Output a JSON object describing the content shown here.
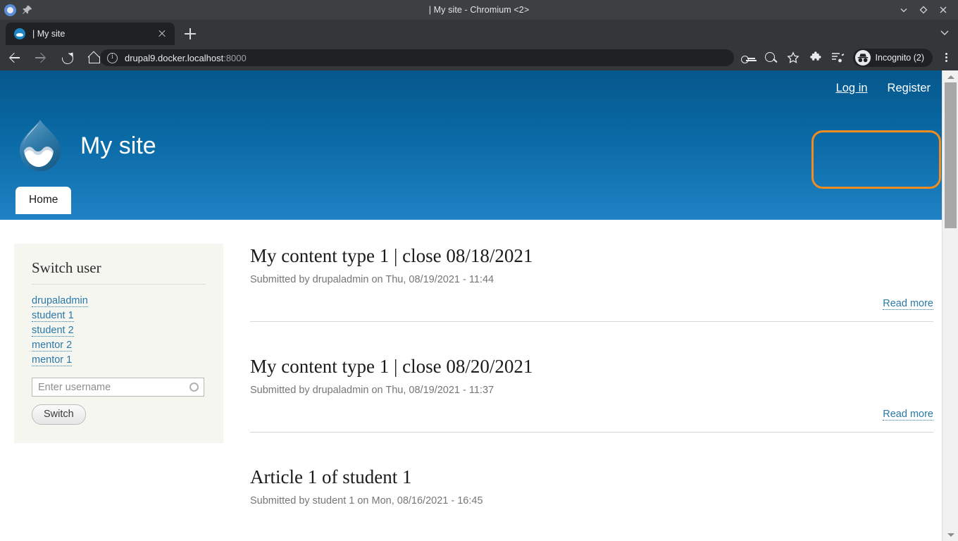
{
  "window": {
    "title": "| My site - Chromium <2>",
    "controls": {
      "minimize": "minimize-icon",
      "maximize": "maximize-icon",
      "close": "close-icon"
    }
  },
  "browser": {
    "tab": {
      "title": "| My site",
      "favicon": "drupal-favicon",
      "close_label": "close-tab"
    },
    "new_tab_label": "new-tab",
    "omnibox": {
      "url_host": "drupal9.docker.localhost",
      "url_port": ":8000",
      "info_icon": "site-info-icon"
    },
    "toolbar_icons": [
      "back-icon",
      "forward-icon",
      "reload-icon",
      "home-icon"
    ],
    "right_icons": [
      "password-key-icon",
      "zoom-icon",
      "bookmark-star-icon",
      "extensions-puzzle-icon",
      "media-control-icon"
    ],
    "profile_chip": {
      "label": "Incognito (2)",
      "icon": "incognito-icon"
    },
    "menu": "chrome-menu-icon"
  },
  "site": {
    "name": "My site",
    "logo": "drupal-droplet-logo",
    "user_links": [
      {
        "label": "Log in",
        "underlined": true
      },
      {
        "label": "Register",
        "underlined": false
      }
    ],
    "primary_tabs": [
      {
        "label": "Home",
        "active": true
      }
    ],
    "highlight_color": "#f08c20",
    "header_gradient": {
      "top": "#05578c",
      "bottom": "#2082c4"
    }
  },
  "sidebar": {
    "block_title": "Switch user",
    "users": [
      "drupaladmin",
      "student 1",
      "student 2",
      "mentor 2",
      "mentor 1"
    ],
    "username_field": {
      "value": "",
      "placeholder": "Enter username"
    },
    "throbber": "autocomplete-throbber-icon",
    "submit_label": "Switch"
  },
  "content": {
    "read_more_label": "Read more",
    "nodes": [
      {
        "title": "My content type 1 | close 08/18/2021",
        "submitted": "Submitted by drupaladmin on Thu, 08/19/2021 - 11:44",
        "has_read_more": true
      },
      {
        "title": "My content type 1 | close 08/20/2021",
        "submitted": "Submitted by drupaladmin on Thu, 08/19/2021 - 11:37",
        "has_read_more": true
      },
      {
        "title": "Article 1 of student 1",
        "submitted": "Submitted by student 1 on Mon, 08/16/2021 - 16:45",
        "has_read_more": false
      }
    ]
  },
  "scrollbar": {
    "name": "page-scrollbar",
    "up": "scroll-up-arrow",
    "down": "scroll-down-arrow"
  }
}
